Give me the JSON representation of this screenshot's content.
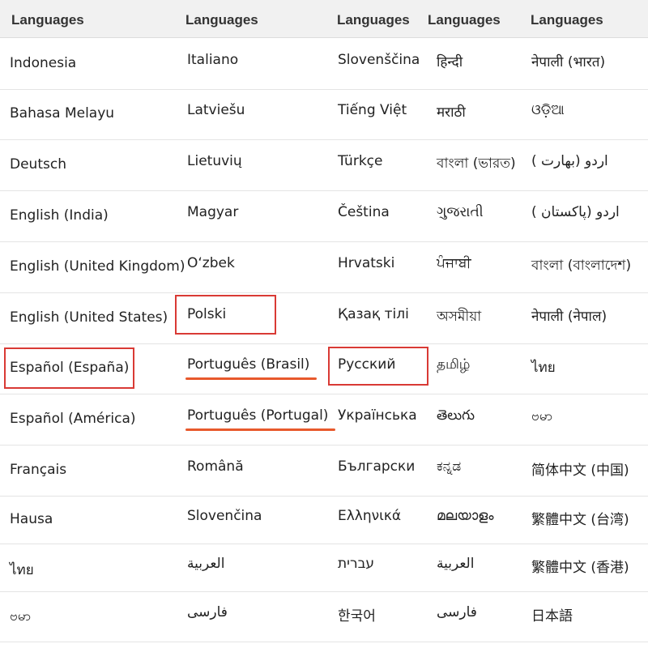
{
  "headers": [
    "Languages",
    "Languages",
    "Languages",
    "Languages",
    "Languages"
  ],
  "rows": [
    [
      "Indonesia",
      "Italiano",
      "Slovenščina",
      "हिन्दी",
      "नेपाली (भारत)"
    ],
    [
      "Bahasa Melayu",
      "Latviešu",
      "Tiếng Việt",
      "मराठी",
      "ଓଡ଼ିଆ"
    ],
    [
      "Deutsch",
      "Lietuvių",
      "Türkçe",
      "বাংলা (ভারত)",
      "اردو (بھارت )"
    ],
    [
      "English (India)",
      "Magyar",
      "Čeština",
      "ગુજરાતી",
      "اردو (پاکستان )"
    ],
    [
      "English (United Kingdom)",
      "O‘zbek",
      "Hrvatski",
      "ਪੰਜਾਬੀ",
      "বাংলা (বাংলাদেশ)"
    ],
    [
      "English (United States)",
      "Polski",
      "Қазақ тілі",
      "অসমীয়া",
      "नेपाली (नेपाल)"
    ],
    [
      "Español (España)",
      "Português (Brasil)",
      "Русский",
      "தமிழ்",
      "ไทย"
    ],
    [
      "Español (América)",
      "Português (Portugal)",
      "Українська",
      "తెలుగు",
      "ဗမာ"
    ],
    [
      "Français",
      "Română",
      "Български",
      "ಕನ್ನಡ",
      "简体中文 (中国)"
    ],
    [
      "Hausa",
      "Slovenčina",
      "Ελληνικά",
      "മലയാളം",
      "繁體中文 (台湾)"
    ],
    [
      "ไทย",
      "العربية",
      "עברית",
      "العربية",
      "繁體中文 (香港)"
    ],
    [
      "ဗမာ",
      "فارسی",
      "한국어",
      "فارسی",
      "日本語"
    ]
  ],
  "highlight_color": "#d93a35",
  "underline_color": "#e8592c"
}
